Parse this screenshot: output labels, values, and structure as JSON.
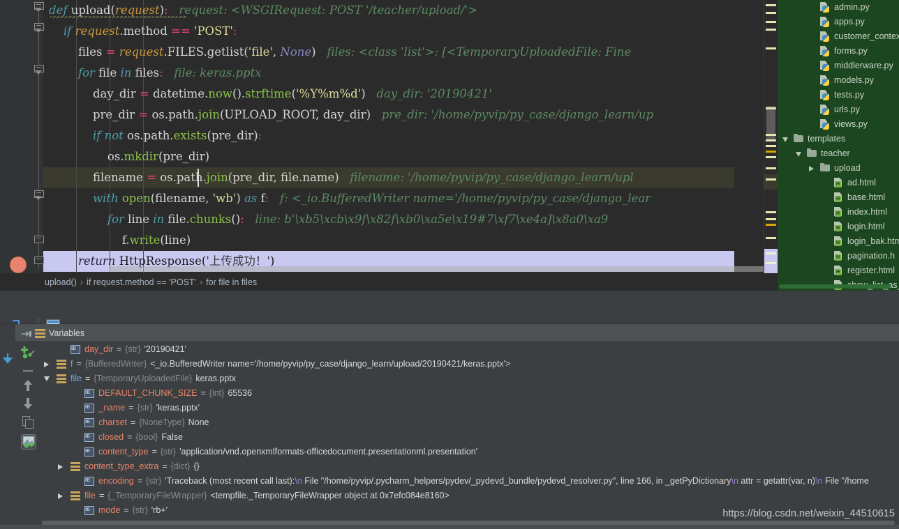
{
  "editor": {
    "language": "python",
    "lines": [
      {
        "indent": 0,
        "tokens": [
          {
            "t": "def ",
            "c": "kw"
          },
          {
            "t": "upload",
            "c": "fn"
          },
          {
            "t": "(",
            "c": "white"
          },
          {
            "t": "request",
            "c": "par"
          },
          {
            "t": ")",
            "c": "white"
          },
          {
            "t": ":",
            "c": "pnk"
          },
          {
            "t": "   request: <WSGIRequest: POST '/teacher/upload/'>",
            "c": "cmt"
          }
        ],
        "plain": "def upload(request):   request: <WSGIRequest: POST '/teacher/upload/'>"
      },
      {
        "indent": 1,
        "plain": "if request.method == 'POST':"
      },
      {
        "indent": 2,
        "plain": "files = request.FILES.getlist('file', None)   files: <class 'list'>: [<TemporaryUploadedFile: Fine"
      },
      {
        "indent": 2,
        "plain": "for file in files:   file: keras.pptx"
      },
      {
        "indent": 3,
        "plain": "day_dir = datetime.now().strftime('%Y%m%d')   day_dir: '20190421'"
      },
      {
        "indent": 3,
        "plain": "pre_dir = os.path.join(UPLOAD_ROOT, day_dir)   pre_dir: '/home/pyvip/py_case/django_learn/up"
      },
      {
        "indent": 3,
        "plain": "if not os.path.exists(pre_dir):"
      },
      {
        "indent": 4,
        "plain": "os.mkdir(pre_dir)"
      },
      {
        "indent": 3,
        "plain": "filename = os.path.join(pre_dir, file.name)   filename: '/home/pyvip/py_case/django_learn/upl"
      },
      {
        "indent": 3,
        "plain": "with open(filename, 'wb') as f:   f: <_io.BufferedWriter name='/home/pyvip/py_case/django_lear"
      },
      {
        "indent": 4,
        "plain": "for line in file.chunks():   line: b'\\xb5\\xcb\\x9f\\x82f\\xb0\\xa5e\\x19#7\\xf7\\xe4a]\\x8a0\\xa9"
      },
      {
        "indent": 5,
        "plain": "f.write(line)"
      },
      {
        "indent": 2,
        "plain": "return HttpResponse('上传成功！')"
      }
    ],
    "execution_line_index": 8,
    "selected_line_index": 12,
    "breakpoint_line_index": 12
  },
  "breadcrumb": {
    "items": [
      "upload()",
      "if request.method == 'POST'",
      "for file in files"
    ],
    "separator": "›"
  },
  "project_tree": {
    "items": [
      {
        "label": "admin.py",
        "icon": "python-file-icon",
        "depth": 3,
        "twisty": "none"
      },
      {
        "label": "apps.py",
        "icon": "python-file-icon",
        "depth": 3,
        "twisty": "none"
      },
      {
        "label": "customer_context",
        "icon": "python-file-icon",
        "depth": 3,
        "twisty": "none"
      },
      {
        "label": "forms.py",
        "icon": "python-file-icon",
        "depth": 3,
        "twisty": "none"
      },
      {
        "label": "middlerware.py",
        "icon": "python-file-icon",
        "depth": 3,
        "twisty": "none"
      },
      {
        "label": "models.py",
        "icon": "python-file-icon",
        "depth": 3,
        "twisty": "none"
      },
      {
        "label": "tests.py",
        "icon": "python-file-icon",
        "depth": 3,
        "twisty": "none"
      },
      {
        "label": "urls.py",
        "icon": "python-file-icon",
        "depth": 3,
        "twisty": "none"
      },
      {
        "label": "views.py",
        "icon": "python-file-icon",
        "depth": 3,
        "twisty": "none"
      },
      {
        "label": "templates",
        "icon": "folder-icon",
        "depth": 1,
        "twisty": "expanded"
      },
      {
        "label": "teacher",
        "icon": "folder-icon",
        "depth": 2,
        "twisty": "expanded"
      },
      {
        "label": "upload",
        "icon": "folder-icon",
        "depth": 3,
        "twisty": "collapsed"
      },
      {
        "label": "ad.html",
        "icon": "html-file-icon",
        "depth": 4,
        "twisty": "none"
      },
      {
        "label": "base.html",
        "icon": "html-file-icon",
        "depth": 4,
        "twisty": "none"
      },
      {
        "label": "index.html",
        "icon": "html-file-icon",
        "depth": 4,
        "twisty": "none"
      },
      {
        "label": "login.html",
        "icon": "html-file-icon",
        "depth": 4,
        "twisty": "none"
      },
      {
        "label": "login_bak.htm",
        "icon": "html-file-icon",
        "depth": 4,
        "twisty": "none"
      },
      {
        "label": "pagination.h",
        "icon": "html-file-icon",
        "depth": 4,
        "twisty": "none"
      },
      {
        "label": "register.html",
        "icon": "html-file-icon",
        "depth": 4,
        "twisty": "none"
      },
      {
        "label": "show_list_as_",
        "icon": "html-file-icon",
        "depth": 4,
        "twisty": "none"
      }
    ]
  },
  "debugger": {
    "toolbar": {
      "buttons": [
        {
          "name": "step-into-my-code-icon",
          "label": ""
        },
        {
          "name": "evaluate-expression-icon",
          "label": ""
        }
      ]
    },
    "variables_pane": {
      "title": "Variables",
      "rows": [
        {
          "depth": 2,
          "twisty": "none",
          "icon": "field-icon",
          "name": "day_dir",
          "name_color": "orange",
          "eq": "=",
          "type": "{str}",
          "value": "'20190421'"
        },
        {
          "depth": 1,
          "twisty": "collapsed",
          "icon": "object-icon",
          "name": "f",
          "name_color": "blue",
          "eq": "=",
          "type": "{BufferedWriter}",
          "value": "<_io.BufferedWriter name='/home/pyvip/py_case/django_learn/upload/20190421/keras.pptx'>"
        },
        {
          "depth": 1,
          "twisty": "expanded",
          "icon": "object-icon",
          "name": "file",
          "name_color": "blue",
          "eq": "=",
          "type": "{TemporaryUploadedFile}",
          "value": "keras.pptx"
        },
        {
          "depth": 3,
          "twisty": "none",
          "icon": "field-icon",
          "name": "DEFAULT_CHUNK_SIZE",
          "name_color": "orange",
          "eq": "=",
          "type": "{int}",
          "value": "65536"
        },
        {
          "depth": 3,
          "twisty": "none",
          "icon": "field-icon",
          "name": "_name",
          "name_color": "orange",
          "eq": "=",
          "type": "{str}",
          "value": "'keras.pptx'"
        },
        {
          "depth": 3,
          "twisty": "none",
          "icon": "field-icon",
          "name": "charset",
          "name_color": "orange",
          "eq": "=",
          "type": "{NoneType}",
          "value": "None"
        },
        {
          "depth": 3,
          "twisty": "none",
          "icon": "field-icon",
          "name": "closed",
          "name_color": "orange",
          "eq": "=",
          "type": "{bool}",
          "value": "False"
        },
        {
          "depth": 3,
          "twisty": "none",
          "icon": "field-icon",
          "name": "content_type",
          "name_color": "orange",
          "eq": "=",
          "type": "{str}",
          "value": "'application/vnd.openxmlformats-officedocument.presentationml.presentation'"
        },
        {
          "depth": 2,
          "twisty": "collapsed",
          "icon": "object-icon",
          "name": "content_type_extra",
          "name_color": "orange",
          "eq": "=",
          "type": "{dict}",
          "value": "{}"
        },
        {
          "depth": 3,
          "twisty": "none",
          "icon": "field-icon",
          "name": "encoding",
          "name_color": "orange",
          "eq": "=",
          "type": "{str}",
          "value": "'Traceback (most recent call last):\\n  File \"/home/pyvip/.pycharm_helpers/pydev/_pydevd_bundle/pydevd_resolver.py\", line 166, in _getPyDictionary\\n    attr = getattr(var, n)\\n  File \"/home"
        },
        {
          "depth": 2,
          "twisty": "collapsed",
          "icon": "object-icon",
          "name": "file",
          "name_color": "orange",
          "eq": "=",
          "type": "{_TemporaryFileWrapper}",
          "value": "<tempfile._TemporaryFileWrapper object at 0x7efc084e8160>"
        },
        {
          "depth": 3,
          "twisty": "none",
          "icon": "field-icon",
          "name": "mode",
          "name_color": "orange",
          "eq": "=",
          "type": "{str}",
          "value": "'rb+'"
        }
      ]
    }
  },
  "watermark": {
    "text": "https://blog.csdn.net/weixin_44510615"
  },
  "colors": {
    "editor_bg": "#2b2b2b",
    "gutter_bg": "#313335",
    "panel_bg": "#3c3f41",
    "tree_bg": "#1b4620",
    "exec_line": "#3a3a2e",
    "selected_line": "#c8c8f0",
    "comment": "#5c8a62",
    "string": "#dcdc9a",
    "keyword": "#4e9ca8",
    "var_name": "#e8846b",
    "var_type": "#8b8b8b"
  }
}
